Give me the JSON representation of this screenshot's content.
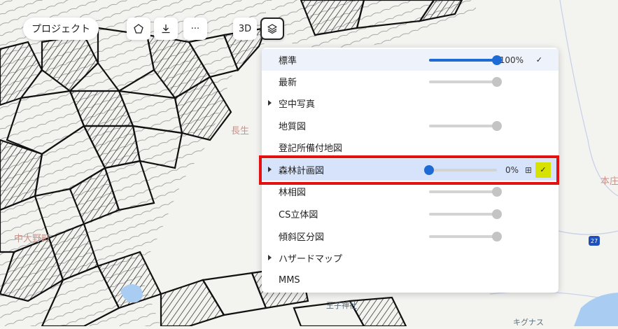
{
  "toolbar": {
    "project_label": "プロジェクト",
    "polygon_icon": "polygon-icon",
    "download_icon": "download-icon",
    "more_label": "···",
    "three_d_label": "3D",
    "layers_icon": "layers-icon"
  },
  "map_labels": {
    "town_naka": "中大野町",
    "town_nagao": "長生",
    "honmachi": "本庄",
    "shrine": "王子神社",
    "store": "キグナス",
    "route": "27"
  },
  "layer_panel": {
    "layers": [
      {
        "name": "標準",
        "expandable": false,
        "opacity": 100,
        "opacity_label": "100%",
        "active": true,
        "check": "✓"
      },
      {
        "name": "最新",
        "expandable": false,
        "opacity": 100
      },
      {
        "name": "空中写真",
        "expandable": true
      },
      {
        "name": "地質図",
        "expandable": false,
        "opacity": 100
      },
      {
        "name": "登記所備付地図",
        "expandable": false
      },
      {
        "name": "森林計画図",
        "expandable": true,
        "opacity": 0,
        "opacity_label": "0%",
        "active": true,
        "table_icon": "table-icon",
        "check": "✓",
        "highlighted": true
      },
      {
        "name": "林相図",
        "expandable": false,
        "opacity": 100
      },
      {
        "name": "CS立体図",
        "expandable": false,
        "opacity": 100
      },
      {
        "name": "傾斜区分図",
        "expandable": false,
        "opacity": 100
      },
      {
        "name": "ハザードマップ",
        "expandable": true
      },
      {
        "name": "MMS",
        "expandable": false
      }
    ]
  },
  "colors": {
    "accent": "#1f6bd6",
    "highlight_box": "#e01212",
    "check_highlight": "#d8e200",
    "selected_row": "#d7e3fa"
  }
}
